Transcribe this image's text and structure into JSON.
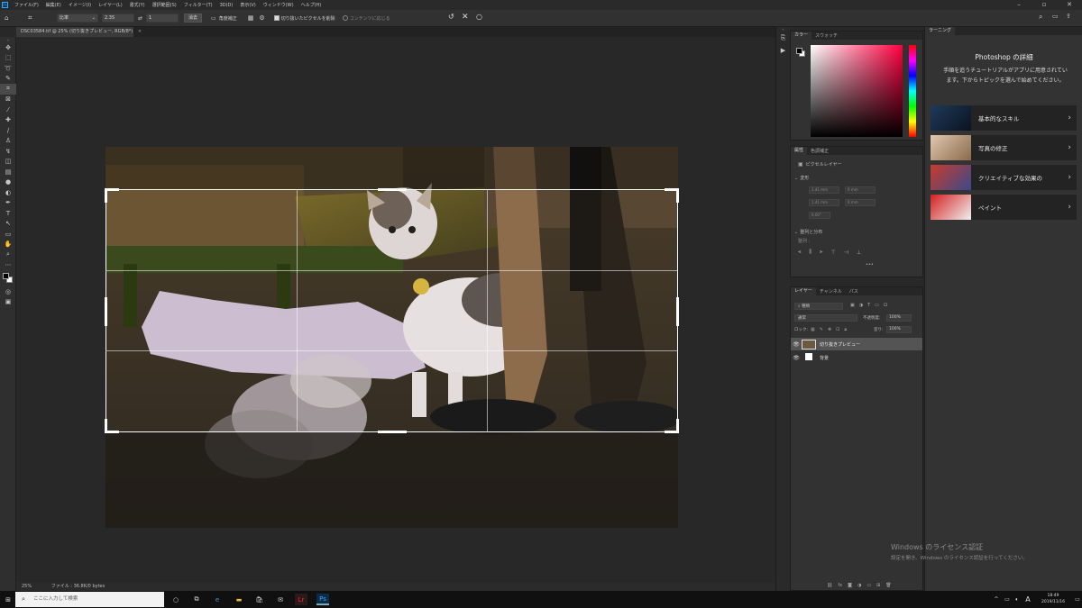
{
  "menubar": {
    "items": [
      "ファイル(F)",
      "編集(E)",
      "イメージ(I)",
      "レイヤー(L)",
      "書式(Y)",
      "選択範囲(S)",
      "フィルター(T)",
      "3D(D)",
      "表示(V)",
      "ウィンドウ(W)",
      "ヘルプ(H)"
    ],
    "logo": "Ps"
  },
  "options": {
    "ratio_select": "比率",
    "width_value": "2.35",
    "height_value": "1",
    "clear_button": "消去",
    "straighten_label": "角度補正",
    "delete_pixels_label": "切り抜いたピクセルを削除",
    "content_aware_label": "コンテンツに応じる"
  },
  "document": {
    "tab_title": "DSC03584.tif @ 25% (切り抜きプレビュー, RGB/8*)",
    "zoom": "25%",
    "file_info": "ファイル : 36.8K/0 bytes"
  },
  "color_panel": {
    "tabs": [
      "カラー",
      "スウォッチ"
    ]
  },
  "properties_panel": {
    "tabs": [
      "属性",
      "色調補正"
    ],
    "layer_type": "ピクセルレイヤー",
    "transform_label": "変形",
    "w1": "1.41 mm",
    "x1": "0 mm",
    "h1": "1.41 mm",
    "y1": "0 mm",
    "angle": "0.00°",
    "align_label": "整列と分布",
    "align_sub": "整列 :",
    "more": "•••"
  },
  "layers_panel": {
    "tabs": [
      "レイヤー",
      "チャンネル",
      "パス"
    ],
    "search_kind": "種類",
    "blend_mode": "通常",
    "opacity_label": "不透明度:",
    "opacity_value": "100%",
    "lock_label": "ロック:",
    "fill_label": "塗り:",
    "fill_value": "100%",
    "layers": [
      {
        "name": "切り抜きプレビュー"
      },
      {
        "name": "背景"
      }
    ]
  },
  "learn_panel": {
    "tab": "ラーニング",
    "title": "Photoshop の詳細",
    "desc": "手順を追うチュートリアルがアプリに用意されています。下からトピックを選んで始めてください。",
    "cards": [
      {
        "label": "基本的なスキル",
        "chevron": "›"
      },
      {
        "label": "写真の修正",
        "chevron": "›"
      },
      {
        "label": "クリエイティブな効果の",
        "chevron": "›"
      },
      {
        "label": "ペイント",
        "chevron": "›"
      }
    ]
  },
  "watermark": {
    "line1": "Windows のライセンス認証",
    "line2": "設定を開き、Windows のライセンス認証を行ってください。"
  },
  "taskbar": {
    "search_placeholder": "ここに入力して検索",
    "time": "18:49",
    "date": "2019/11/16",
    "ime": "A"
  },
  "colors": {
    "accent": "#31a8ff",
    "panel_bg": "#323232",
    "canvas_bg": "#282828"
  }
}
